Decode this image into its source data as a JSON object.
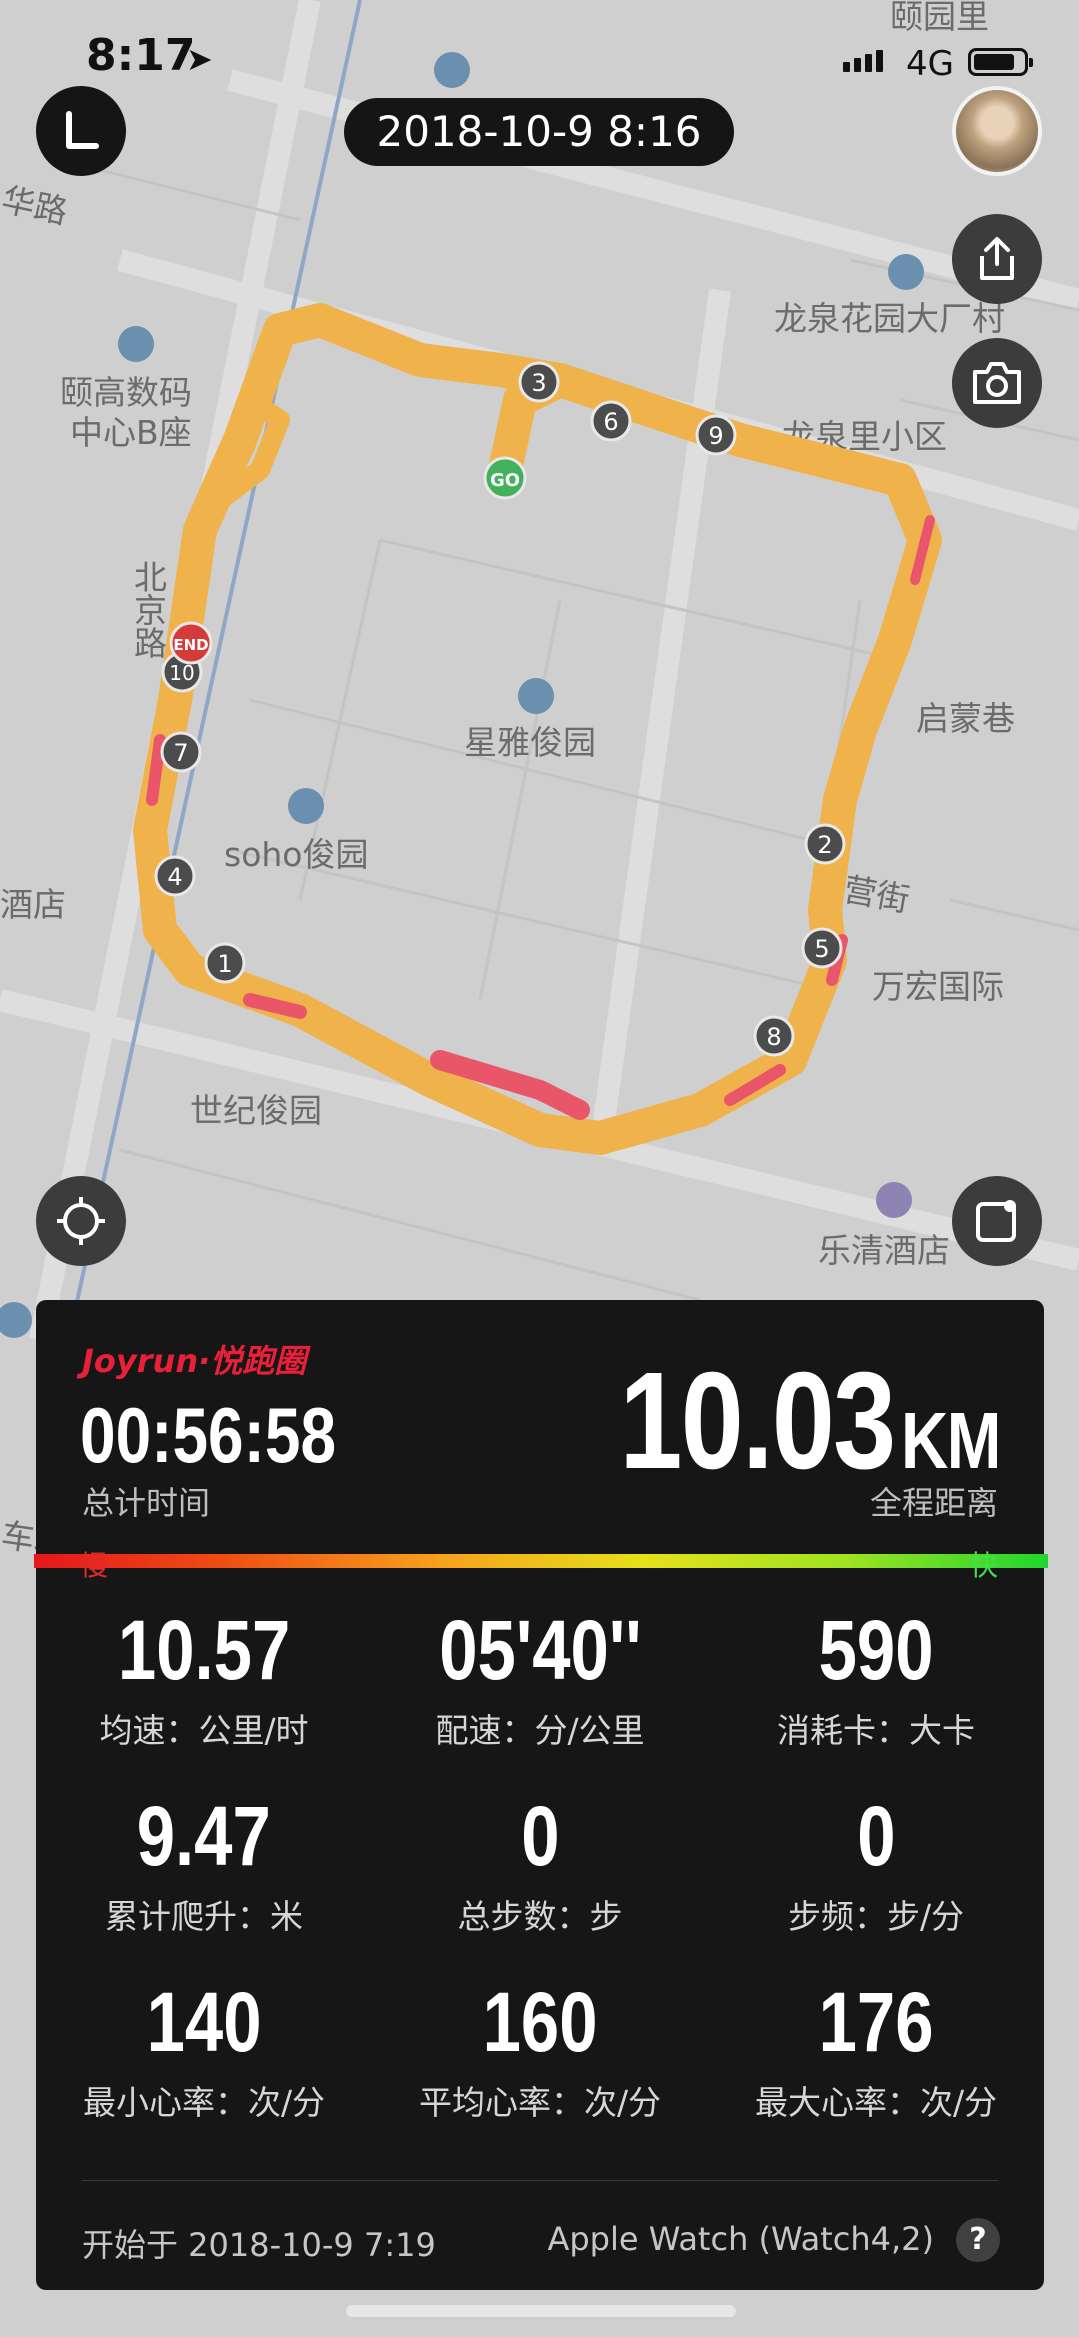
{
  "status_bar": {
    "time": "8:17",
    "network": "4G"
  },
  "header": {
    "date": "2018-10-9 8:16"
  },
  "map": {
    "labels": [
      "颐园里",
      "华路",
      "龙泉花园大厂村",
      "颐高数码",
      "中心B座",
      "龙泉里小区",
      "北京路",
      "星雅俊园",
      "启蒙巷",
      "soho俊园",
      "酒店",
      "营街",
      "万宏国际",
      "世纪俊园",
      "乐清酒店",
      "车北路"
    ],
    "route_markers": [
      "1",
      "2",
      "3",
      "4",
      "5",
      "6",
      "7",
      "8",
      "9",
      "10"
    ],
    "start_marker": "GO",
    "end_marker": "END"
  },
  "summary": {
    "brand": "Joyrun·悦跑圈",
    "total_time": "00:56:58",
    "total_time_label": "总计时间",
    "distance": "10.03",
    "distance_unit": "KM",
    "distance_label": "全程距离",
    "speed_slow": "慢",
    "speed_fast": "快"
  },
  "stats": [
    {
      "value": "10.57",
      "label": "均速：公里/时"
    },
    {
      "value": "05'40''",
      "label": "配速：分/公里"
    },
    {
      "value": "590",
      "label": "消耗卡：大卡"
    },
    {
      "value": "9.47",
      "label": "累计爬升：米"
    },
    {
      "value": "0",
      "label": "总步数：步"
    },
    {
      "value": "0",
      "label": "步频：步/分"
    },
    {
      "value": "140",
      "label": "最小心率：次/分"
    },
    {
      "value": "160",
      "label": "平均心率：次/分"
    },
    {
      "value": "176",
      "label": "最大心率：次/分"
    }
  ],
  "footer": {
    "start": "开始于 2018-10-9 7:19",
    "device": "Apple Watch (Watch4,2)",
    "help": "?"
  },
  "colors": {
    "route": "#f0b24a",
    "route_slow": "#e9566a",
    "panel": "#161616",
    "brand": "#e8203a"
  }
}
